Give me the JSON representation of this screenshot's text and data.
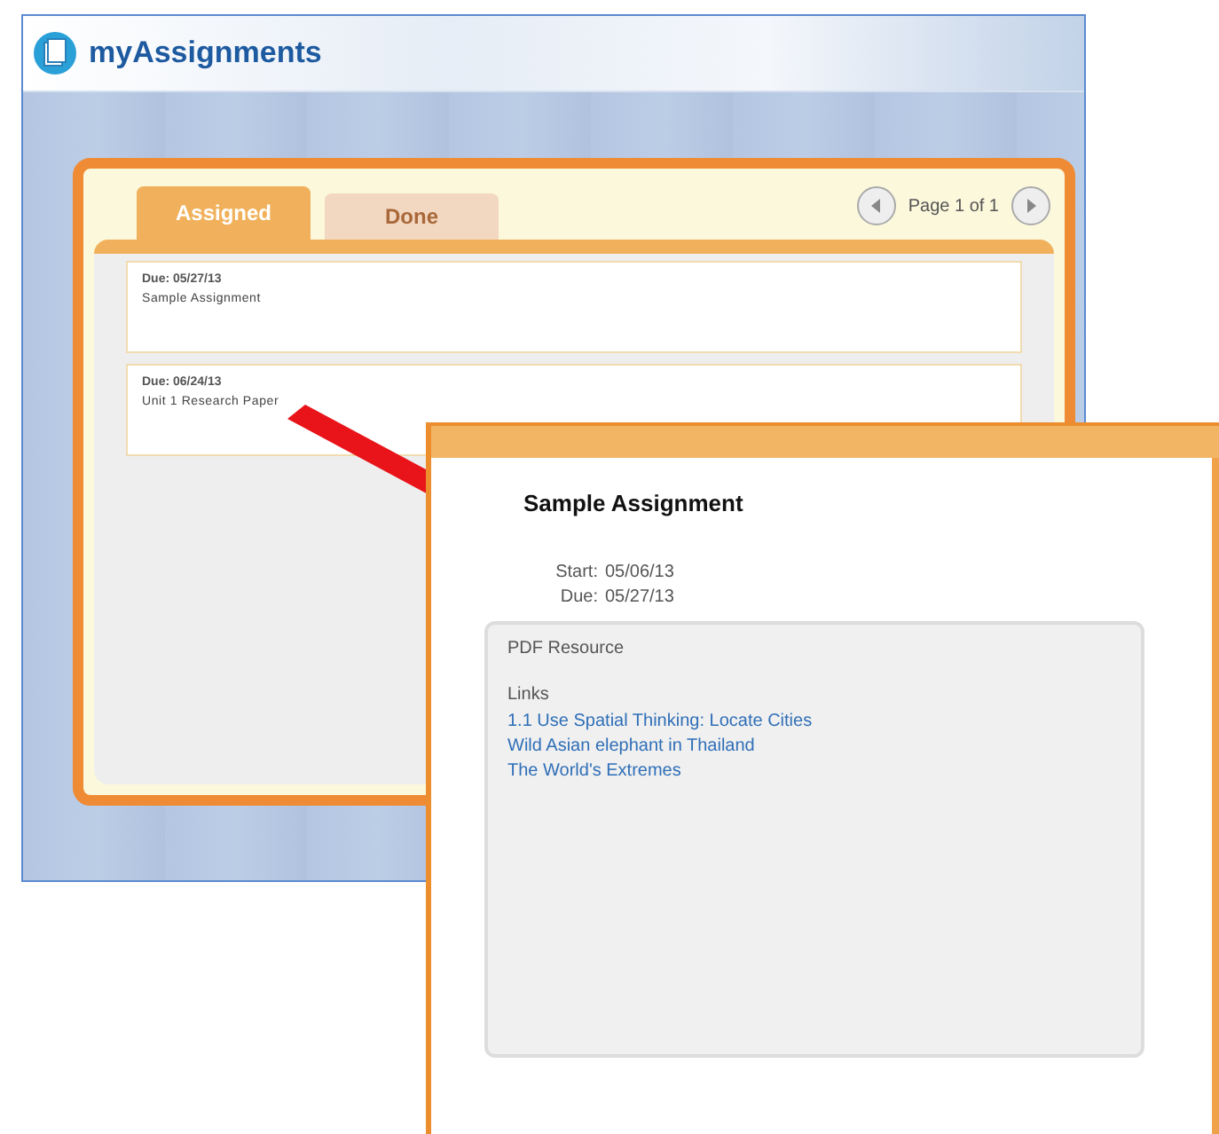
{
  "app": {
    "title": "myAssignments"
  },
  "tabs": [
    {
      "label": "Assigned",
      "selected": true
    },
    {
      "label": "Done",
      "selected": false
    }
  ],
  "pager": {
    "text": "Page 1 of 1"
  },
  "assignments": [
    {
      "due": "Due: 05/27/13",
      "title": "Sample Assignment"
    },
    {
      "due": "Due: 06/24/13",
      "title": "Unit 1 Research Paper"
    }
  ],
  "detail": {
    "title": "Sample Assignment",
    "start_label": "Start:",
    "start": "05/06/13",
    "due_label": "Due:",
    "due": "05/27/13",
    "resource": "PDF Resource",
    "links_label": "Links",
    "links": [
      "1.1 Use Spatial Thinking: Locate Cities",
      "Wild Asian elephant in Thailand",
      "The World's Extremes"
    ]
  }
}
